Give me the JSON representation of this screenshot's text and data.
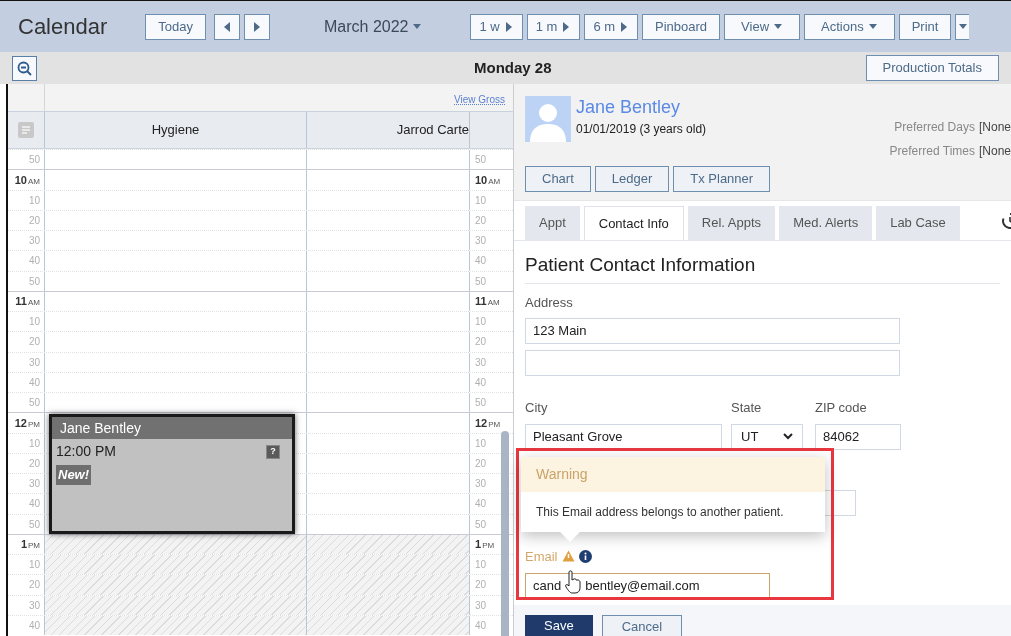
{
  "toolbar": {
    "title": "Calendar",
    "items": [
      {
        "kind": "button",
        "label": "Today"
      },
      {
        "kind": "prev"
      },
      {
        "kind": "next"
      },
      {
        "kind": "month",
        "label": "March 2022"
      },
      {
        "kind": "play",
        "label": "1 w"
      },
      {
        "kind": "play",
        "label": "1 m"
      },
      {
        "kind": "play",
        "label": "6 m"
      },
      {
        "kind": "button",
        "label": "Pinboard"
      },
      {
        "kind": "menu",
        "label": "View"
      },
      {
        "kind": "menu",
        "label": "Actions"
      },
      {
        "kind": "button",
        "label": "Print"
      },
      {
        "kind": "split"
      }
    ]
  },
  "day_bar": {
    "title": "Monday 28",
    "button": "Production Totals"
  },
  "calendar": {
    "link": "View Gross",
    "columns": [
      "Hygiene",
      "Jarrod Carte"
    ],
    "rows": [
      {
        "kind": "minute",
        "label": "50",
        "right_label": "50",
        "hatched": false
      },
      {
        "kind": "hour",
        "label": "10",
        "suffix": "AM",
        "right_label": "10",
        "right_suffix": "AM",
        "hatched": false
      },
      {
        "kind": "minute",
        "label": "10",
        "right_label": "10",
        "hatched": false
      },
      {
        "kind": "minute",
        "label": "20",
        "right_label": "20",
        "hatched": false
      },
      {
        "kind": "minute",
        "label": "30",
        "right_label": "30",
        "hatched": false
      },
      {
        "kind": "minute",
        "label": "40",
        "right_label": "40",
        "hatched": false
      },
      {
        "kind": "minute",
        "label": "50",
        "right_label": "50",
        "hatched": false
      },
      {
        "kind": "hour",
        "label": "11",
        "suffix": "AM",
        "right_label": "11",
        "right_suffix": "AM",
        "hatched": false
      },
      {
        "kind": "minute",
        "label": "10",
        "right_label": "10",
        "hatched": false
      },
      {
        "kind": "minute",
        "label": "20",
        "right_label": "20",
        "hatched": false
      },
      {
        "kind": "minute",
        "label": "30",
        "right_label": "30",
        "hatched": false
      },
      {
        "kind": "minute",
        "label": "40",
        "right_label": "40",
        "hatched": false
      },
      {
        "kind": "minute",
        "label": "50",
        "right_label": "50",
        "hatched": false
      },
      {
        "kind": "hour",
        "label": "12",
        "suffix": "PM",
        "right_label": "12",
        "right_suffix": "PM",
        "hatched": false,
        "appointment": {
          "name": "Jane Bentley",
          "time": "12:00 PM",
          "badge": "New!",
          "status": "?"
        }
      },
      {
        "kind": "minute",
        "label": "10",
        "right_label": "10",
        "hatched": false
      },
      {
        "kind": "minute",
        "label": "20",
        "right_label": "20",
        "hatched": false
      },
      {
        "kind": "minute",
        "label": "30",
        "right_label": "30",
        "hatched": false
      },
      {
        "kind": "minute",
        "label": "40",
        "right_label": "40",
        "hatched": false
      },
      {
        "kind": "minute",
        "label": "50",
        "right_label": "50",
        "hatched": false
      },
      {
        "kind": "hour",
        "label": "1",
        "suffix": "PM",
        "right_label": "1",
        "right_suffix": "PM",
        "hatched": true
      },
      {
        "kind": "minute",
        "label": "10",
        "right_label": "10",
        "hatched": true
      },
      {
        "kind": "minute",
        "label": "20",
        "right_label": "20",
        "hatched": true
      },
      {
        "kind": "minute",
        "label": "30",
        "right_label": "30",
        "hatched": true
      },
      {
        "kind": "minute",
        "label": "40",
        "right_label": "40",
        "hatched": true
      }
    ]
  },
  "patient": {
    "name": "Jane Bentley",
    "dob": "01/01/2019 (3 years old)",
    "preferences": [
      {
        "label": "Preferred Days",
        "value": "[None"
      },
      {
        "label": "Preferred Times",
        "value": "[None"
      }
    ],
    "buttons": [
      "Chart",
      "Ledger",
      "Tx Planner"
    ]
  },
  "tabs": [
    {
      "label": "Appt",
      "selected": false
    },
    {
      "label": "Contact Info",
      "selected": true
    },
    {
      "label": "Rel. Appts",
      "selected": false
    },
    {
      "label": "Med. Alerts",
      "selected": false
    },
    {
      "label": "Lab Case",
      "selected": false
    }
  ],
  "form": {
    "title": "Patient Contact Information",
    "address": {
      "label": "Address",
      "value": "123 Main"
    },
    "city": {
      "label": "City",
      "value": "Pleasant Grove"
    },
    "state": {
      "label": "State",
      "value": "UT"
    },
    "zip": {
      "label": "ZIP code",
      "value": "84062"
    },
    "email": {
      "label": "Email",
      "value_start": "cand",
      "value_end": "bentley@email.com",
      "warning": true
    },
    "warning": {
      "title": "Warning",
      "message": "This Email address belongs to another patient."
    },
    "actions": [
      "Save",
      "Cancel"
    ]
  }
}
